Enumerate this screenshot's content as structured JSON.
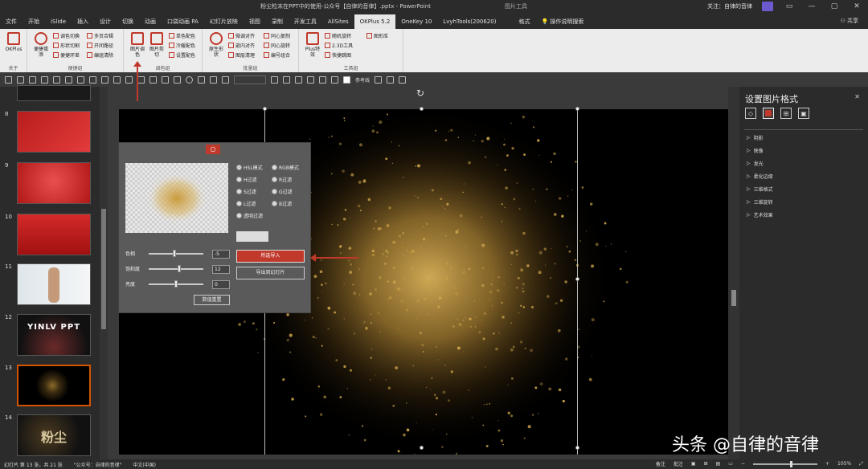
{
  "window": {
    "title": "粉尘粒末在PPT中的使用-公众号【自律的音律】.pptx - PowerPoint",
    "context_tab": "图片工具",
    "user": "关注：自律的音律",
    "controls": [
      "—",
      "▢",
      "✕"
    ]
  },
  "tabs": [
    {
      "label": "文件"
    },
    {
      "label": "开始"
    },
    {
      "label": "iSlide"
    },
    {
      "label": "插入"
    },
    {
      "label": "设计"
    },
    {
      "label": "切换"
    },
    {
      "label": "动画"
    },
    {
      "label": "口袋动画 PA"
    },
    {
      "label": "幻灯片放映"
    },
    {
      "label": "视图"
    },
    {
      "label": "录制"
    },
    {
      "label": "开发工具"
    },
    {
      "label": "AllSites"
    },
    {
      "label": "OKPlus 5.2"
    },
    {
      "label": "OneKey 10"
    },
    {
      "label": "LvyhTools(200620)"
    },
    {
      "label": "格式"
    },
    {
      "label": "操作说明搜索"
    }
  ],
  "active_tab": "OKPlus 5.2",
  "share_label": "共享",
  "ribbon": {
    "groups": [
      {
        "name": "关于",
        "big": [
          "OKPlus"
        ],
        "small": []
      },
      {
        "name": "便捷组",
        "big": [
          "便捷增添"
        ],
        "small": [
          "调色切换",
          "形状切割",
          "便捷环差",
          "多页合辑",
          "开闭路径",
          "编组清除"
        ]
      },
      {
        "name": "调色组",
        "big": [
          "图片调色",
          "图片剪切"
        ],
        "small": [
          "单色配色",
          "冷暖配色",
          "设置配色"
        ]
      },
      {
        "name": "批量组",
        "big": [
          "原生形状"
        ],
        "small": [
          "微调对齐",
          "嵌内对齐",
          "图层清理",
          "同心复制",
          "同心旋转",
          "编号组合"
        ]
      },
      {
        "name": "工具组",
        "big": [
          "Plus特效"
        ],
        "small": [
          "随机旋转",
          "2.3D工具",
          "快捷跳图",
          "图形库"
        ]
      }
    ]
  },
  "qat": {
    "font_name": "",
    "text_label": "参考线"
  },
  "slides": [
    {
      "num": "",
      "label": ""
    },
    {
      "num": "8",
      "label": ""
    },
    {
      "num": "9",
      "label": ""
    },
    {
      "num": "10",
      "label": ""
    },
    {
      "num": "11",
      "label": ""
    },
    {
      "num": "12",
      "label": "YINLV PPT"
    },
    {
      "num": "13",
      "label": ""
    },
    {
      "num": "14",
      "label": "粉尘"
    }
  ],
  "selected_slide": "13",
  "dialog": {
    "close_label": "○",
    "modes": [
      {
        "label": "HSL模式",
        "selected": true
      },
      {
        "label": "RGB模式",
        "selected": false
      },
      {
        "label": "H过滤",
        "selected": false
      },
      {
        "label": "R过滤",
        "selected": false
      },
      {
        "label": "S过滤",
        "selected": false
      },
      {
        "label": "G过滤",
        "selected": false
      },
      {
        "label": "L过滤",
        "selected": false
      },
      {
        "label": "B过滤",
        "selected": false
      },
      {
        "label": "透明过滤",
        "selected": false
      }
    ],
    "sliders": [
      {
        "label": "色相",
        "value": "-5",
        "pos": 0.47
      },
      {
        "label": "饱和度",
        "value": "12",
        "pos": 0.56
      },
      {
        "label": "亮度",
        "value": "0",
        "pos": 0.5
      }
    ],
    "reset_label": "数值重置",
    "apply_label": "所选导入",
    "export_label": "导出到幻灯片"
  },
  "format_pane": {
    "title": "设置图片格式",
    "close_label": "✕",
    "sections": [
      "阴影",
      "映像",
      "发光",
      "柔化边缘",
      "三维格式",
      "三维旋转",
      "艺术效果"
    ]
  },
  "status": {
    "slide_info": "幻灯片 第 13 张，共 21 张",
    "theme": "\"公众号：自律的音律\"",
    "language": "中文(中国)",
    "notes_label": "备注",
    "comments_label": "批注",
    "zoom": "105%"
  },
  "watermark": "头条 @自律的音律",
  "colors": {
    "accent": "#c0392b",
    "gold": "#c9a14a",
    "dark": "#2b2b2b"
  }
}
